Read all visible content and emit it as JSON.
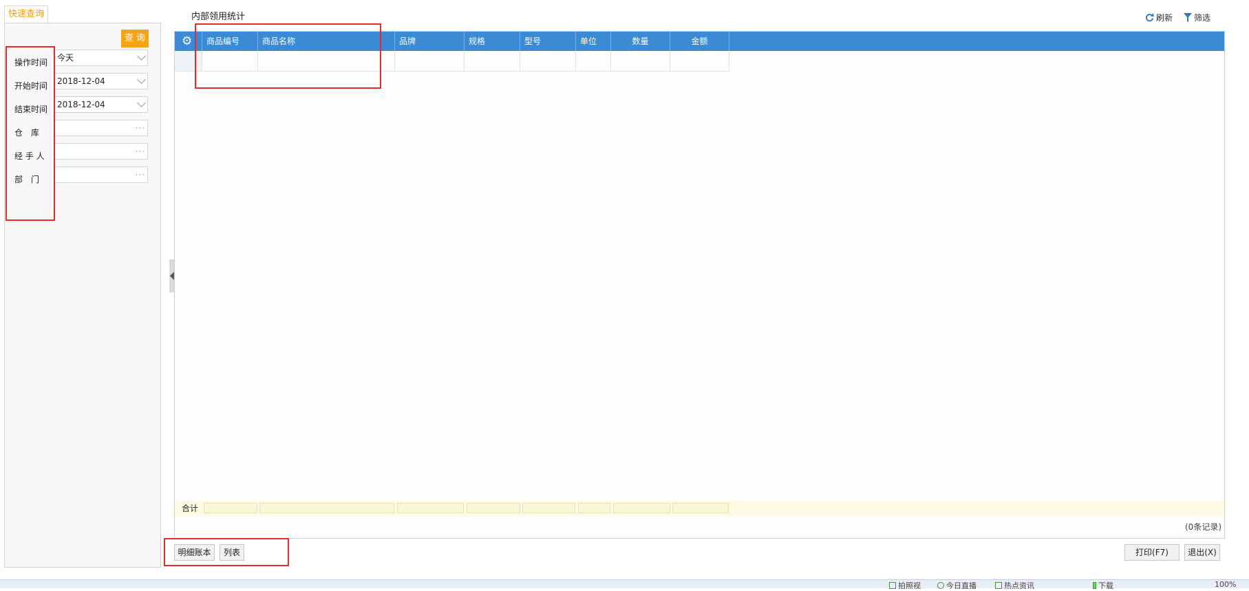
{
  "left_panel": {
    "tab_label": "快速查询",
    "query_button": "查 询",
    "fields": [
      {
        "label": "操作时间",
        "value": "今天",
        "control": "select"
      },
      {
        "label": "开始时间",
        "value": "2018-12-04",
        "control": "select"
      },
      {
        "label": "结束时间",
        "value": "2018-12-04",
        "control": "select"
      },
      {
        "label": "仓　库",
        "value": "",
        "control": "picker"
      },
      {
        "label": "经 手 人",
        "value": "",
        "control": "picker"
      },
      {
        "label": "部　门",
        "value": "",
        "control": "picker"
      }
    ]
  },
  "header": {
    "title": "内部领用统计",
    "refresh_label": "刷新",
    "filter_label": "筛选"
  },
  "grid": {
    "columns": [
      "商品编号",
      "商品名称",
      "品牌",
      "规格",
      "型号",
      "单位",
      "数量",
      "金额"
    ],
    "total_label": "合计",
    "record_count": "(0条记录)"
  },
  "bottom": {
    "detail_ledger_button": "明细账本",
    "list_button": "列表",
    "print_button": "打印(F7)",
    "exit_button": "退出(X)"
  },
  "status_bar": {
    "items": [
      "拍照视",
      "今日直播",
      "热点资讯",
      "下载",
      "100%"
    ]
  },
  "colors": {
    "accent_orange": "#f7a318",
    "grid_header_blue": "#3a8ad6",
    "highlight_red": "#e82a2a",
    "total_row": "#fdfbe3"
  }
}
